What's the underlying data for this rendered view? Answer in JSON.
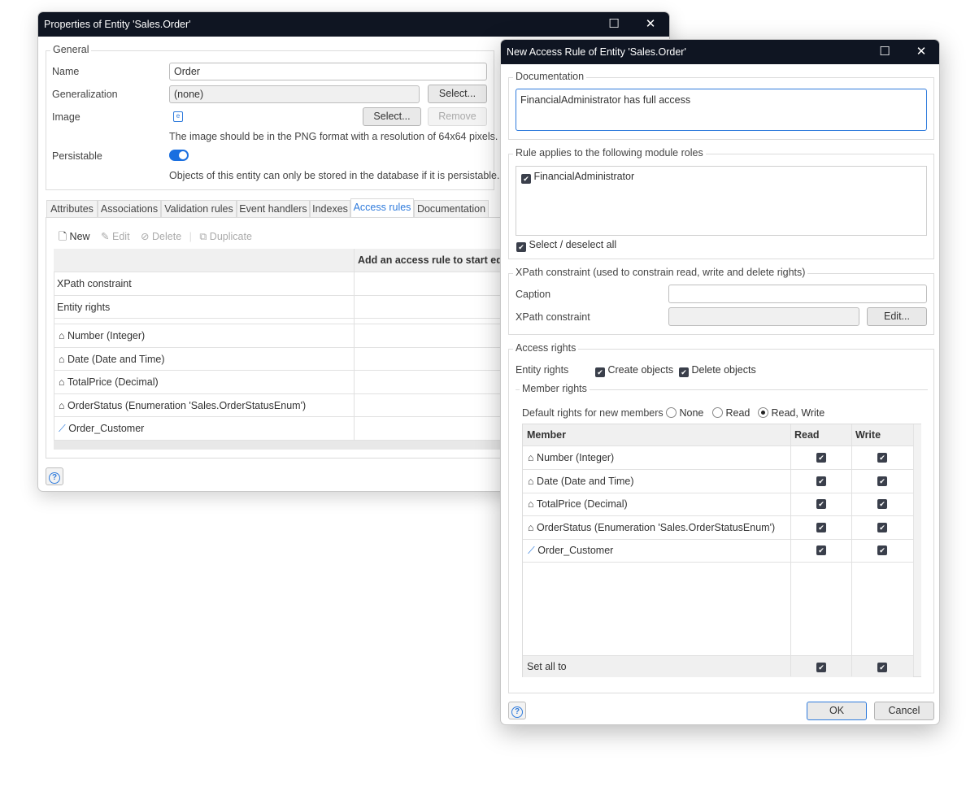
{
  "props": {
    "title": "Properties of Entity 'Sales.Order'",
    "general": {
      "legend": "General",
      "name_label": "Name",
      "name_value": "Order",
      "generalization_label": "Generalization",
      "generalization_value": "(none)",
      "select_label": "Select...",
      "image_label": "Image",
      "image_select_label": "Select...",
      "remove_label": "Remove",
      "image_hint": "The image should be in the PNG format with a resolution of 64x64 pixels.",
      "persistable_label": "Persistable",
      "persistable_on": true,
      "persistable_hint": "Objects of this entity can only be stored in the database if it is persistable."
    },
    "tabs": [
      "Attributes",
      "Associations",
      "Validation rules",
      "Event handlers",
      "Indexes",
      "Access rules",
      "Documentation"
    ],
    "active_tab": "Access rules",
    "toolbar": {
      "new": "New",
      "edit": "Edit",
      "delete": "Delete",
      "duplicate": "Duplicate"
    },
    "table": {
      "header": "Add an access rule to start editing",
      "rows": [
        "XPath constraint",
        "Entity rights"
      ],
      "members": [
        "Number (Integer)",
        "Date (Date and Time)",
        "TotalPrice (Decimal)",
        "OrderStatus (Enumeration 'Sales.OrderStatusEnum')",
        "Order_Customer"
      ]
    }
  },
  "rule": {
    "title": "New Access Rule of Entity 'Sales.Order'",
    "documentation": {
      "legend": "Documentation",
      "value": "FinancialAdministrator has full access"
    },
    "roles": {
      "legend": "Rule applies to the following module roles",
      "items": [
        {
          "label": "FinancialAdministrator",
          "checked": true
        }
      ],
      "select_all": "Select / deselect all"
    },
    "xpath": {
      "legend": "XPath constraint (used to constrain read, write and delete rights)",
      "caption_label": "Caption",
      "caption_value": "",
      "xpath_label": "XPath constraint",
      "xpath_value": "",
      "edit": "Edit..."
    },
    "access": {
      "legend": "Access rights",
      "entity_rights_label": "Entity rights",
      "create": "Create objects",
      "delete": "Delete objects",
      "member_rights_legend": "Member rights",
      "default_label": "Default rights for new members",
      "options": [
        "None",
        "Read",
        "Read, Write"
      ],
      "selected": "Read, Write",
      "columns": [
        "Member",
        "Read",
        "Write"
      ],
      "members": [
        {
          "name": "Number (Integer)",
          "type": "attribute",
          "read": true,
          "write": true
        },
        {
          "name": "Date (Date and Time)",
          "type": "attribute",
          "read": true,
          "write": true
        },
        {
          "name": "TotalPrice (Decimal)",
          "type": "attribute",
          "read": true,
          "write": true
        },
        {
          "name": "OrderStatus (Enumeration 'Sales.OrderStatusEnum')",
          "type": "attribute",
          "read": true,
          "write": true
        },
        {
          "name": "Order_Customer",
          "type": "association",
          "read": true,
          "write": true
        }
      ],
      "set_all": "Set all to"
    },
    "ok": "OK",
    "cancel": "Cancel"
  },
  "colors": {
    "titlebar": "#0f1522",
    "accent": "#2f7bdc"
  }
}
